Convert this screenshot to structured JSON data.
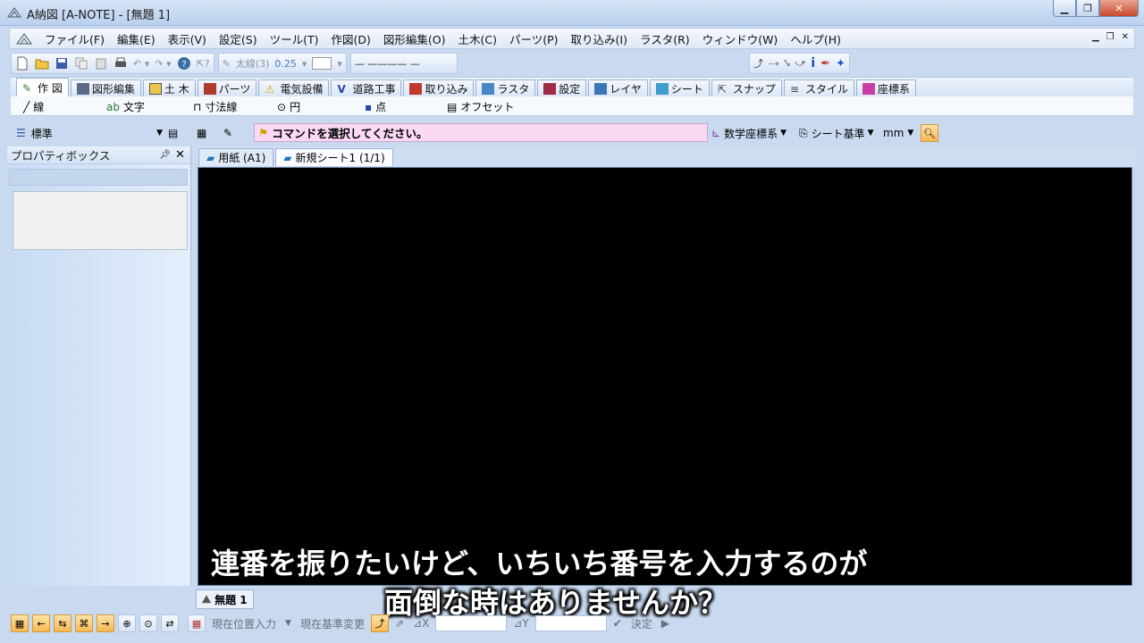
{
  "window": {
    "title": "A納図 [A-NOTE] - [無題 1]"
  },
  "menu": [
    "ファイル(F)",
    "編集(E)",
    "表示(V)",
    "設定(S)",
    "ツール(T)",
    "作図(D)",
    "図形編集(O)",
    "土木(C)",
    "パーツ(P)",
    "取り込み(I)",
    "ラスタ(R)",
    "ウィンドウ(W)",
    "ヘルプ(H)"
  ],
  "toolbar": {
    "line_weight": "太線(3)",
    "line_width_value": "0.25"
  },
  "tabs": [
    "作 図",
    "図形編集",
    "土 木",
    "パーツ",
    "電気設備",
    "道路工事",
    "取り込み",
    "ラスタ",
    "設定",
    "レイヤ",
    "シート",
    "スナップ",
    "スタイル",
    "座標系"
  ],
  "commands": [
    "線",
    "文字",
    "寸法線",
    "円",
    "点",
    "オフセット"
  ],
  "toolbar3": {
    "style_combo": "標準",
    "message": "コマンドを選択してください。",
    "coord_system": "数学座標系",
    "sheet_basis": "シート基準",
    "unit": "mm"
  },
  "property_box": {
    "title": "プロパティボックス"
  },
  "sheet_tabs": [
    "用紙 (A1)",
    "新規シート1 (1/1)"
  ],
  "doc_tab": "無題 1",
  "subtitles": {
    "line1": "連番を振りたいけど、いちいち番号を入力するのが",
    "line2": "面倒な時はありませんか？"
  },
  "statusbar": {
    "current_pos_input": "現在位置入力",
    "current_basis_change": "現在基準変更",
    "dx_label": "⊿X",
    "dy_label": "⊿Y",
    "decide": "決定"
  },
  "colors": {
    "canvas": "#000000",
    "message_bg": "#fbd9f4",
    "accent": "#3a6ea5"
  }
}
